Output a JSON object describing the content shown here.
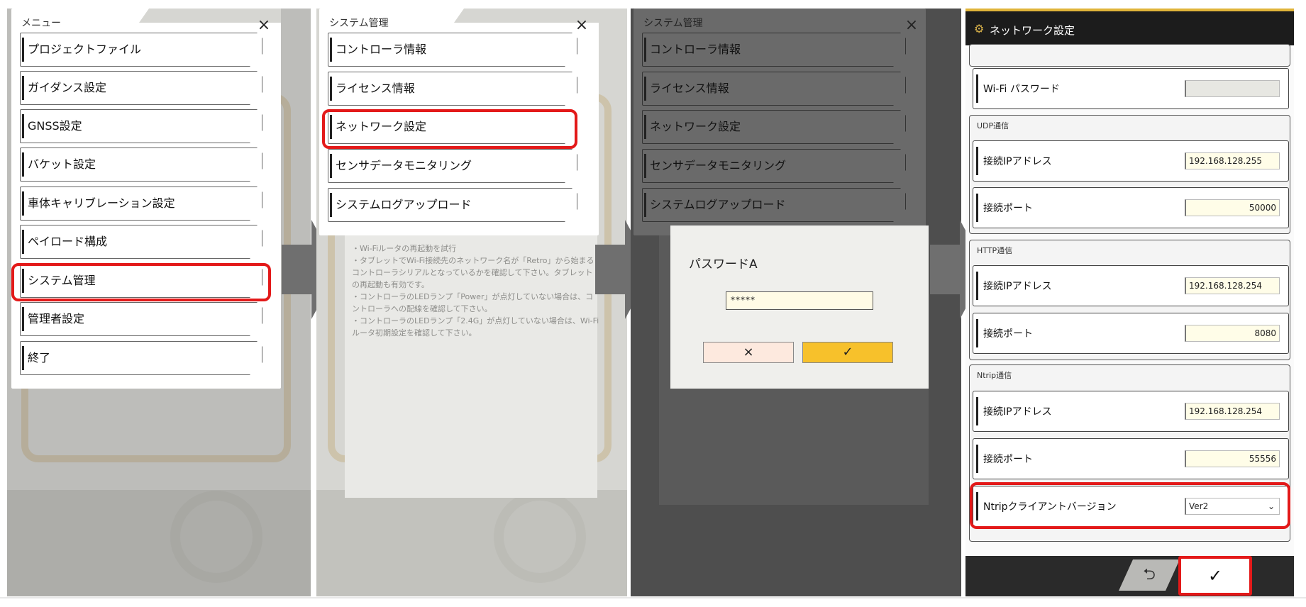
{
  "panel1": {
    "title": "メニュー",
    "close": "×",
    "items": [
      {
        "label": "プロジェクトファイル"
      },
      {
        "label": "ガイダンス設定"
      },
      {
        "label": "GNSS設定"
      },
      {
        "label": "バケット設定"
      },
      {
        "label": "車体キャリブレーション設定"
      },
      {
        "label": "ペイロード構成"
      },
      {
        "label": "システム管理"
      },
      {
        "label": "管理者設定"
      },
      {
        "label": "終了"
      }
    ]
  },
  "panel2": {
    "title": "システム管理",
    "close": "×",
    "items": [
      {
        "label": "コントローラ情報"
      },
      {
        "label": "ライセンス情報"
      },
      {
        "label": "ネットワーク設定"
      },
      {
        "label": "センサデータモニタリング"
      },
      {
        "label": "システムログアップロード"
      }
    ],
    "notes": [
      "・Wi-Fiルータの再起動を試行",
      "・タブレットでWi-Fi接続先のネットワーク名が「Retro」から始まるコントローラシリアルとなっているかを確認して下さい。タブレットの再起動も有効です。",
      "・コントローラのLEDランプ「Power」が点灯していない場合は、コントローラへの配線を確認して下さい。",
      "・コントローラのLEDランプ「2.4G」が点灯していない場合は、Wi-Fiルータ初期設定を確認して下さい。"
    ]
  },
  "panel3": {
    "title": "システム管理",
    "close": "×",
    "items": [
      {
        "label": "コントローラ情報"
      },
      {
        "label": "ライセンス情報"
      },
      {
        "label": "ネットワーク設定"
      },
      {
        "label": "センサデータモニタリング"
      },
      {
        "label": "システムログアップロード"
      }
    ],
    "dialog": {
      "title": "パスワードA",
      "password_value": "*****",
      "cancel_icon": "×",
      "ok_icon": "✓"
    }
  },
  "panel4": {
    "header_title": "ネットワーク設定",
    "wifi_password_label": "Wi-Fi パスワード",
    "udp": {
      "section": "UDP通信",
      "ip_label": "接続IPアドレス",
      "ip_value": "192.168.128.255",
      "port_label": "接続ポート",
      "port_value": "50000"
    },
    "http": {
      "section": "HTTP通信",
      "ip_label": "接続IPアドレス",
      "ip_value": "192.168.128.254",
      "port_label": "接続ポート",
      "port_value": "8080"
    },
    "ntrip": {
      "section": "Ntrip通信",
      "ip_label": "接続IPアドレス",
      "ip_value": "192.168.128.254",
      "port_label": "接続ポート",
      "port_value": "55556",
      "version_label": "Ntripクライアントバージョン",
      "version_value": "Ver2"
    },
    "back_icon": "⮌",
    "confirm_icon": "✓"
  },
  "colors": {
    "highlight": "#e31919",
    "ok_button": "#f7c12b",
    "cancel_button": "#fde9de",
    "header_bg": "#1c1c1c",
    "accent": "#e0b43a"
  }
}
